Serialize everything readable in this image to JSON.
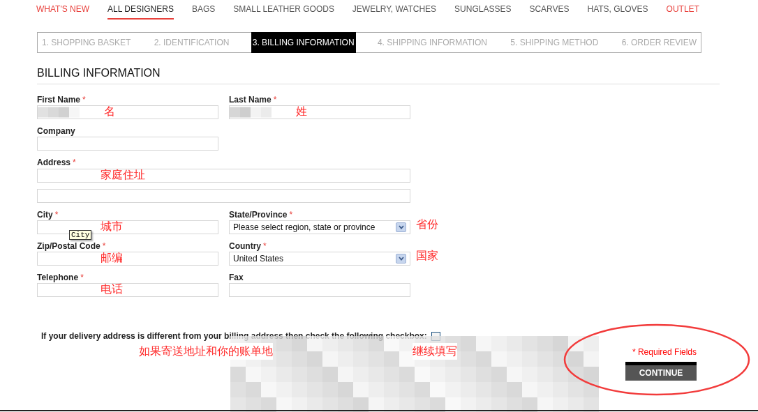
{
  "nav": [
    {
      "label": "WHAT'S NEW",
      "selected": false,
      "color": "#e8413c"
    },
    {
      "label": "ALL DESIGNERS",
      "selected": true,
      "color": "#222222"
    },
    {
      "label": "BAGS",
      "selected": false,
      "color": "#555555"
    },
    {
      "label": "SMALL LEATHER GOODS",
      "selected": false,
      "color": "#555555"
    },
    {
      "label": "JEWELRY, WATCHES",
      "selected": false,
      "color": "#555555"
    },
    {
      "label": "SUNGLASSES",
      "selected": false,
      "color": "#555555"
    },
    {
      "label": "SCARVES",
      "selected": false,
      "color": "#555555"
    },
    {
      "label": "HATS, GLOVES",
      "selected": false,
      "color": "#555555"
    },
    {
      "label": "OUTLET",
      "selected": false,
      "color": "#e8413c"
    }
  ],
  "steps": [
    {
      "label": "1. SHOPPING BASKET",
      "selected": false
    },
    {
      "label": "2. IDENTIFICATION",
      "selected": false
    },
    {
      "label": "3. BILLING INFORMATION",
      "selected": true
    },
    {
      "label": "4. SHIPPING INFORMATION",
      "selected": false
    },
    {
      "label": "5. SHIPPING METHOD",
      "selected": false
    },
    {
      "label": "6. ORDER REVIEW",
      "selected": false
    }
  ],
  "heading": "BILLING INFORMATION",
  "rows": [
    [
      {
        "label": "First Name",
        "required_mark": "*",
        "kind": "text",
        "redacted": true,
        "annotation": "名"
      },
      {
        "label": "Last Name",
        "required_mark": "*",
        "kind": "text",
        "redacted": true,
        "annotation": "姓"
      }
    ],
    [
      {
        "label": "Company",
        "kind": "text"
      }
    ],
    [
      {
        "label": "Address",
        "required_mark": "*",
        "kind": "address",
        "annotation": "家庭住址"
      }
    ],
    [
      {
        "label": "City",
        "required_mark": "*",
        "kind": "text",
        "annotation": "城市",
        "tooltip": "City"
      },
      {
        "label": "State/Province",
        "required_mark": "*",
        "kind": "select",
        "value": "Please select region, state or province",
        "side_note": "省份"
      }
    ],
    [
      {
        "label": "Zip/Postal Code",
        "required_mark": "*",
        "kind": "text",
        "annotation": "邮编"
      },
      {
        "label": "Country",
        "required_mark": "*",
        "kind": "select",
        "value": "United States",
        "side_note": "国家"
      }
    ],
    [
      {
        "label": "Telephone",
        "required_mark": "*",
        "kind": "text",
        "annotation": "电话"
      },
      {
        "label": "Fax",
        "kind": "text"
      }
    ]
  ],
  "checkbox": {
    "label": "If your delivery address is different from your billing address then check the following checkbox:",
    "checked": false
  },
  "note_parts": [
    "如果寄送地址和你的账单地",
    "继续填写"
  ],
  "required_note": "* Required Fields",
  "continue_button": "CONTINUE"
}
